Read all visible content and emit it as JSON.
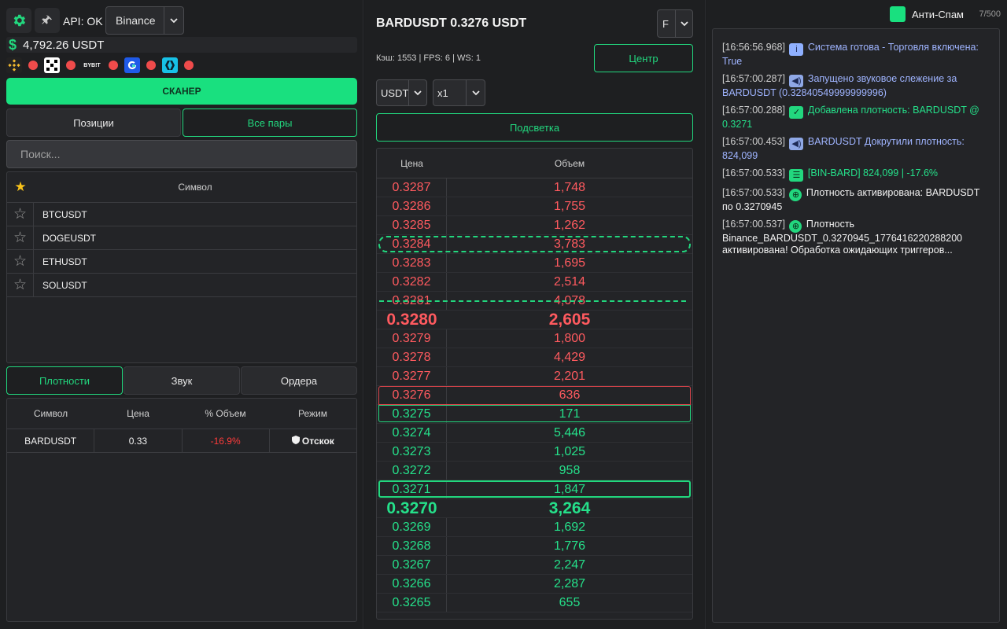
{
  "header": {
    "api_status": "API: OK",
    "exchange": "Binance",
    "balance": "4,792.26 USDT",
    "bybit_label": "BYB!T",
    "scanner_label": "СКАНЕР"
  },
  "tabs_top": [
    "Позиции",
    "Все пары"
  ],
  "search": {
    "placeholder": "Поиск..."
  },
  "symbols": {
    "header": "Символ",
    "rows": [
      "BTCUSDT",
      "DOGEUSDT",
      "ETHUSDT",
      "SOLUSDT"
    ]
  },
  "tabs_bottom": [
    "Плотности",
    "Звук",
    "Ордера"
  ],
  "density_table": {
    "headers": [
      "Символ",
      "Цена",
      "% Объем",
      "Режим"
    ],
    "rows": [
      {
        "symbol": "BARDUSDT",
        "price": "0.33",
        "pct": "-16.9%",
        "mode": "Отскок"
      }
    ]
  },
  "mid": {
    "title": "BARDUSDT 0.3276 USDT",
    "f_select": "F",
    "stats": "Кэш: 1553 | FPS: 6 | WS: 1",
    "center_btn": "Центр",
    "quote_select": "USDT",
    "mult_select": "x1",
    "highlight_btn": "Подсветка",
    "book_headers": [
      "Цена",
      "Объем"
    ],
    "asks": [
      [
        "0.3287",
        "1,748"
      ],
      [
        "0.3286",
        "1,755"
      ],
      [
        "0.3285",
        "1,262"
      ],
      [
        "0.3284",
        "3,783"
      ],
      [
        "0.3283",
        "1,695"
      ],
      [
        "0.3282",
        "2,514"
      ],
      [
        "0.3281",
        "4,078"
      ]
    ],
    "best_ask": [
      "0.3280",
      "2,605"
    ],
    "asks2": [
      [
        "0.3279",
        "1,800"
      ],
      [
        "0.3278",
        "4,429"
      ],
      [
        "0.3277",
        "2,201"
      ],
      [
        "0.3276",
        "636"
      ]
    ],
    "bids": [
      [
        "0.3275",
        "171"
      ],
      [
        "0.3274",
        "5,446"
      ],
      [
        "0.3273",
        "1,025"
      ],
      [
        "0.3272",
        "958"
      ],
      [
        "0.3271",
        "1,847"
      ]
    ],
    "best_bid": [
      "0.3270",
      "3,264"
    ],
    "bids2": [
      [
        "0.3269",
        "1,692"
      ],
      [
        "0.3268",
        "1,776"
      ],
      [
        "0.3267",
        "2,247"
      ],
      [
        "0.3266",
        "2,287"
      ],
      [
        "0.3265",
        "655"
      ]
    ]
  },
  "right": {
    "antispam_label": "Анти-Спам",
    "counter": "7/500",
    "log": [
      {
        "ts": "[16:56:56.968]",
        "icon": "info-icon",
        "cls": "t-blue",
        "text": "Система готова - Торговля включена: True"
      },
      {
        "ts": "[16:57:00.287]",
        "icon": "speaker-icon",
        "cls": "t-blue",
        "text": "Запущено звуковое слежение за BARDUSDT (0.32840549999999996)"
      },
      {
        "ts": "[16:57:00.288]",
        "icon": "check-icon",
        "cls": "t-green",
        "text": "Добавлена плотность: BARDUSDT @ 0.3271"
      },
      {
        "ts": "[16:57:00.453]",
        "icon": "speaker-icon",
        "cls": "t-blue",
        "text": "BARDUSDT Докрутили плотность: 824,099"
      },
      {
        "ts": "[16:57:00.533]",
        "icon": "bars-icon",
        "cls": "t-green",
        "text": "[BIN-BARD] 824,099 | -17.6%"
      },
      {
        "ts": "[16:57:00.533]",
        "icon": "target-icon",
        "cls": "t-white",
        "text": "Плотность активирована: BARDUSDT по 0.3270945"
      },
      {
        "ts": "[16:57:00.537]",
        "icon": "target-icon",
        "cls": "t-white",
        "text": "Плотность Binance_BARDUSDT_0.3270945_1776416220288200 активирована! Обработка ожидающих триггеров..."
      }
    ]
  },
  "colors": {
    "accent": "#19e07f",
    "ask": "#ff5a5f",
    "bid": "#25e08a",
    "star": "#f7c21a"
  }
}
